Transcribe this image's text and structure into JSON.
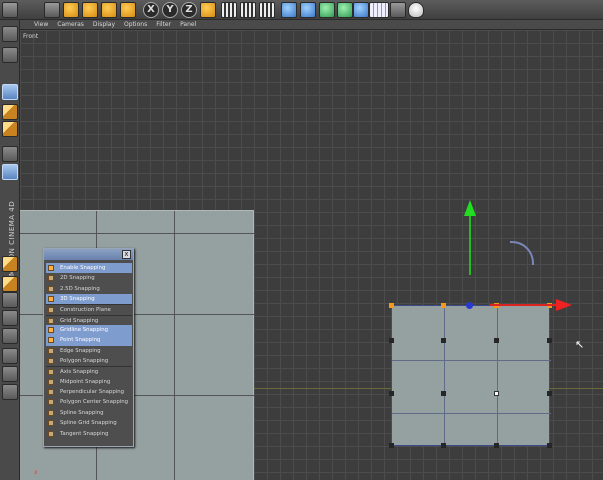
{
  "viewport": {
    "menu": [
      "View",
      "Cameras",
      "Display",
      "Options",
      "Filter",
      "Panel"
    ],
    "view_name": "Front"
  },
  "branding": {
    "text": "MAXON CINEMA 4D"
  },
  "toolbar": {
    "axis_buttons": [
      "X",
      "Y",
      "Z"
    ]
  },
  "snapping_panel": {
    "close_label": "x",
    "items": [
      {
        "label": "Enable Snapping",
        "checked": true
      },
      {
        "label": "2D Snapping",
        "checked": false
      },
      {
        "label": "2.5D Snapping",
        "checked": false
      },
      {
        "label": "3D Snapping",
        "checked": true
      },
      {
        "label": "Construction Plane",
        "checked": false
      },
      {
        "label": "Grid Snapping",
        "checked": false
      },
      {
        "label": "Gridline Snapping",
        "checked": true
      },
      {
        "label": "Point Snapping",
        "checked": true
      },
      {
        "label": "Edge Snapping",
        "checked": false
      },
      {
        "label": "Polygon Snapping",
        "checked": false
      },
      {
        "label": "Axis Snapping",
        "checked": false
      },
      {
        "label": "Midpoint Snapping",
        "checked": false
      },
      {
        "label": "Perpendicular Snapping",
        "checked": false
      },
      {
        "label": "Polygon Center Snapping",
        "checked": false
      },
      {
        "label": "Spline Snapping",
        "checked": false
      },
      {
        "label": "Spline Grid Snapping",
        "checked": false
      },
      {
        "label": "Tangent Snapping",
        "checked": false
      }
    ]
  },
  "gizmo": {
    "mini_axis_label": "x"
  },
  "icons": {
    "toolbar": [
      "undo-icon",
      "select-icon",
      "move-icon",
      "scale-icon",
      "rotate-icon",
      "add-icon",
      "x-axis-icon",
      "y-axis-icon",
      "z-axis-icon",
      "world-coordinate-icon",
      "render-view-icon",
      "render-picture-queue-icon",
      "render-settings-icon",
      "cube-icon",
      "spline-pen-icon",
      "nurbs-icon",
      "array-icon",
      "deformer-icon",
      "keyboard-icon",
      "scene-icon",
      "light-icon"
    ],
    "palette": [
      "make-editable-icon",
      "texture-mode-icon",
      "model-mode-icon",
      "object-axis-icon",
      "points-mode-icon",
      "workplane-icon",
      "snap-icon",
      "edges-icon",
      "polygons-icon",
      "tweak-icon",
      "locking-icon",
      "mesh-check-icon",
      "magnet-icon"
    ]
  },
  "colors": {
    "accent_selected": "#7e9ccd",
    "y_axis": "#22dd22",
    "x_axis": "#ee2222",
    "point_orange": "#f39a1a"
  }
}
